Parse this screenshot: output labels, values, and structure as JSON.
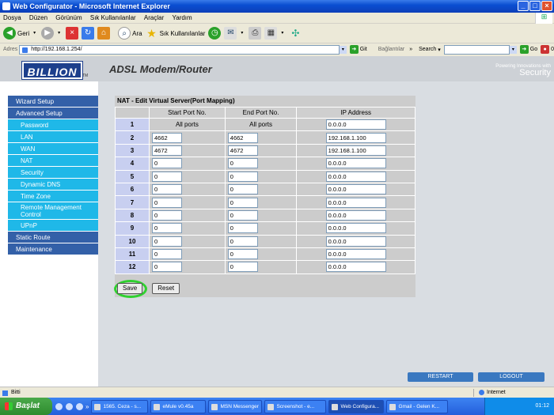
{
  "window": {
    "title": "Web Configurator - Microsoft Internet Explorer"
  },
  "menu": [
    "Dosya",
    "Düzen",
    "Görünüm",
    "Sık Kullanılanlar",
    "Araçlar",
    "Yardım"
  ],
  "toolbar": {
    "back": "Geri",
    "search": "Ara",
    "favorites": "Sık Kullanılanlar"
  },
  "address": {
    "label": "Adres",
    "url": "http://192.168.1.254/",
    "go": "Git",
    "links": "Bağlantılar",
    "search_label": "Search",
    "go2": "Go",
    "count": "0"
  },
  "header": {
    "logo": "BILLION",
    "tm": "TM",
    "title": "ADSL Modem/Router",
    "tagline_top": "Powering Innovations with",
    "tagline_bottom": "Security"
  },
  "sidebar": {
    "items": [
      {
        "label": "Wizard Setup",
        "type": "main"
      },
      {
        "label": "Advanced Setup",
        "type": "main"
      },
      {
        "label": "Password",
        "type": "sub"
      },
      {
        "label": "LAN",
        "type": "sub"
      },
      {
        "label": "WAN",
        "type": "sub"
      },
      {
        "label": "NAT",
        "type": "sub"
      },
      {
        "label": "Security",
        "type": "sub"
      },
      {
        "label": "Dynamic DNS",
        "type": "sub"
      },
      {
        "label": "Time Zone",
        "type": "sub"
      },
      {
        "label": "Remote Management Control",
        "type": "sub2"
      },
      {
        "label": "UPnP",
        "type": "sub"
      },
      {
        "label": "Static Route",
        "type": "main"
      },
      {
        "label": "Maintenance",
        "type": "main"
      }
    ]
  },
  "nat": {
    "title": "NAT - Edit Virtual Server(Port Mapping)",
    "columns": [
      "Start Port No.",
      "End Port No.",
      "IP Address"
    ],
    "rows": [
      {
        "idx": "1",
        "start": "All ports",
        "end": "All ports",
        "ip": "0.0.0.0",
        "static": true
      },
      {
        "idx": "2",
        "start": "4662",
        "end": "4662",
        "ip": "192.168.1.100"
      },
      {
        "idx": "3",
        "start": "4672",
        "end": "4672",
        "ip": "192.168.1.100"
      },
      {
        "idx": "4",
        "start": "0",
        "end": "0",
        "ip": "0.0.0.0"
      },
      {
        "idx": "5",
        "start": "0",
        "end": "0",
        "ip": "0.0.0.0"
      },
      {
        "idx": "6",
        "start": "0",
        "end": "0",
        "ip": "0.0.0.0"
      },
      {
        "idx": "7",
        "start": "0",
        "end": "0",
        "ip": "0.0.0.0"
      },
      {
        "idx": "8",
        "start": "0",
        "end": "0",
        "ip": "0.0.0.0"
      },
      {
        "idx": "9",
        "start": "0",
        "end": "0",
        "ip": "0.0.0.0"
      },
      {
        "idx": "10",
        "start": "0",
        "end": "0",
        "ip": "0.0.0.0"
      },
      {
        "idx": "11",
        "start": "0",
        "end": "0",
        "ip": "0.0.0.0"
      },
      {
        "idx": "12",
        "start": "0",
        "end": "0",
        "ip": "0.0.0.0"
      }
    ],
    "save": "Save",
    "reset": "Reset"
  },
  "bottom": {
    "restart": "RESTART",
    "logout": "LOGOUT"
  },
  "status": {
    "left": "Bitti",
    "zone": "Internet"
  },
  "taskbar": {
    "start": "Başlat",
    "tasks": [
      "1565. Ceza - s...",
      "eMule v0.45a",
      "MSN Messenger",
      "Screenshot - e...",
      "Web Configura...",
      "Gmail - Gelen K..."
    ],
    "clock": "01:12"
  },
  "colors": {
    "sidebar_main": "#3360a8",
    "sidebar_sub": "#1fb8e8",
    "highlight": "#2fd12f"
  }
}
